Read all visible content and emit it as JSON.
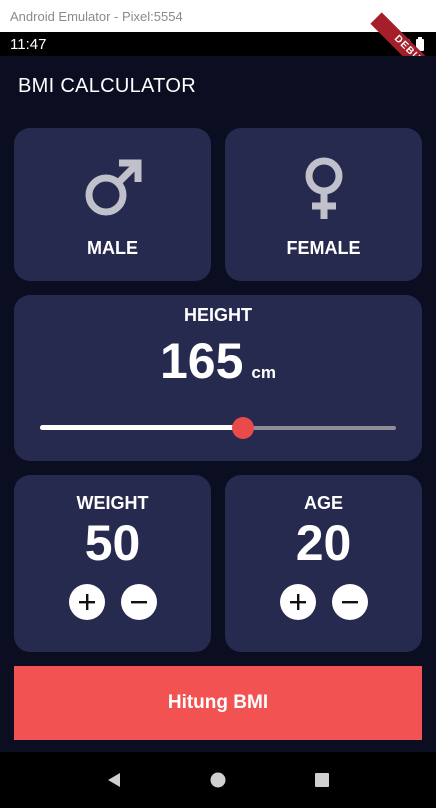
{
  "window": {
    "title": "Android Emulator - Pixel:5554"
  },
  "status_bar": {
    "time": "11:47",
    "debug_banner": "DEBUG"
  },
  "app_bar": {
    "title": "BMI CALCULATOR"
  },
  "gender": {
    "male_label": "MALE",
    "female_label": "FEMALE",
    "icon_color": "#c0c1cb"
  },
  "height": {
    "label": "HEIGHT",
    "value": "165",
    "unit": "cm",
    "slider_fraction": 0.57,
    "thumb_color": "#eb4a4a"
  },
  "weight": {
    "label": "WEIGHT",
    "value": "50"
  },
  "age": {
    "label": "AGE",
    "value": "20"
  },
  "buttons": {
    "calculate": "Hitung BMI",
    "calculate_color": "#f35252"
  },
  "colors": {
    "card": "#272a4f",
    "background": "#0b0e21"
  }
}
